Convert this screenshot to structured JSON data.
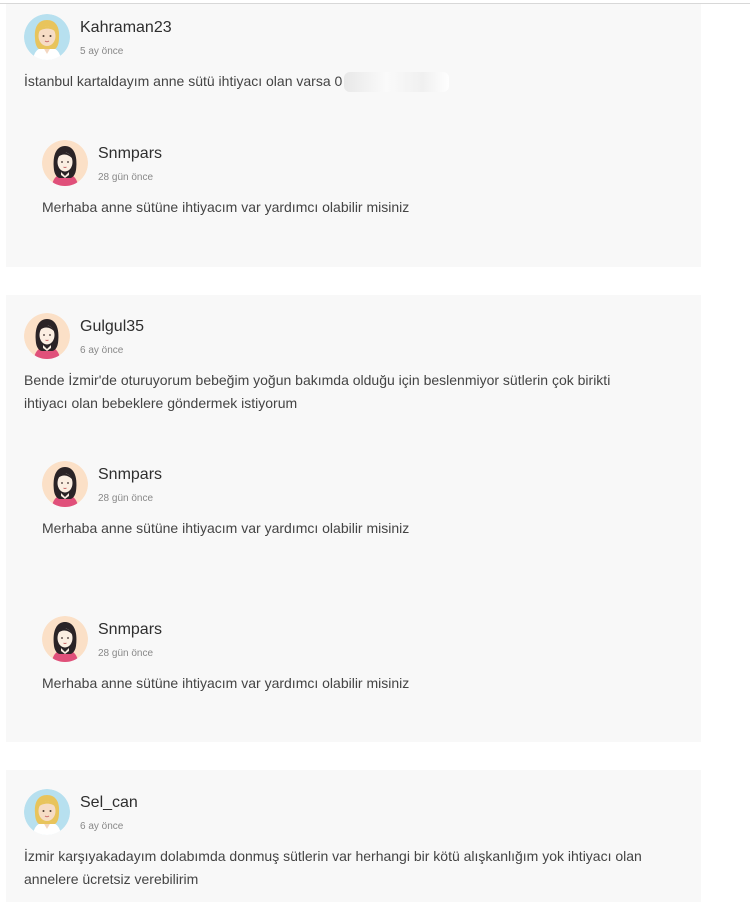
{
  "threads": [
    {
      "user": {
        "name": "Kahraman23",
        "time": "5 ay önce",
        "avatar": "blonde-avatar-icon"
      },
      "text_lines": [
        "İstanbul kartaldayım anne sütü ihtiyacı olan varsa 0"
      ],
      "replies": [
        {
          "name": "Snmpars",
          "time": "28 gün önce",
          "avatar": "dark-hair-avatar-icon",
          "text": "Merhaba anne sütüne ihtiyacım var yardımcı olabilir misiniz"
        }
      ]
    },
    {
      "user": {
        "name": "Gulgul35",
        "time": "6 ay önce",
        "avatar": "dark-hair-avatar-icon"
      },
      "text_lines": [
        "Bende İzmir'de oturuyorum bebeğim yoğun bakımda olduğu için beslenmiyor sütlerin çok birikti",
        "ihtiyacı olan bebeklere göndermek istiyorum"
      ],
      "replies": [
        {
          "name": "Snmpars",
          "time": "28 gün önce",
          "avatar": "dark-hair-avatar-icon",
          "text": "Merhaba anne sütüne ihtiyacım var yardımcı olabilir misiniz"
        },
        {
          "name": "Snmpars",
          "time": "28 gün önce",
          "avatar": "dark-hair-avatar-icon",
          "text": "Merhaba anne sütüne ihtiyacım var yardımcı olabilir misiniz"
        }
      ]
    },
    {
      "user": {
        "name": "Sel_can",
        "time": "6 ay önce",
        "avatar": "blonde-avatar-icon"
      },
      "text_lines": [
        "İzmir karşıyakadayım dolabımda donmuş sütlerin var herhangi bir kötü alışkanlığım yok ihtiyacı olan",
        "annelere ücretsiz verebilirim"
      ],
      "replies": []
    }
  ],
  "colors": {
    "card_bg": "#f8f8f8",
    "avatar_blonde_bg": "#b7e0ef",
    "avatar_dark_bg": "#fbe0c7",
    "shirt_pink": "#e0507a"
  }
}
